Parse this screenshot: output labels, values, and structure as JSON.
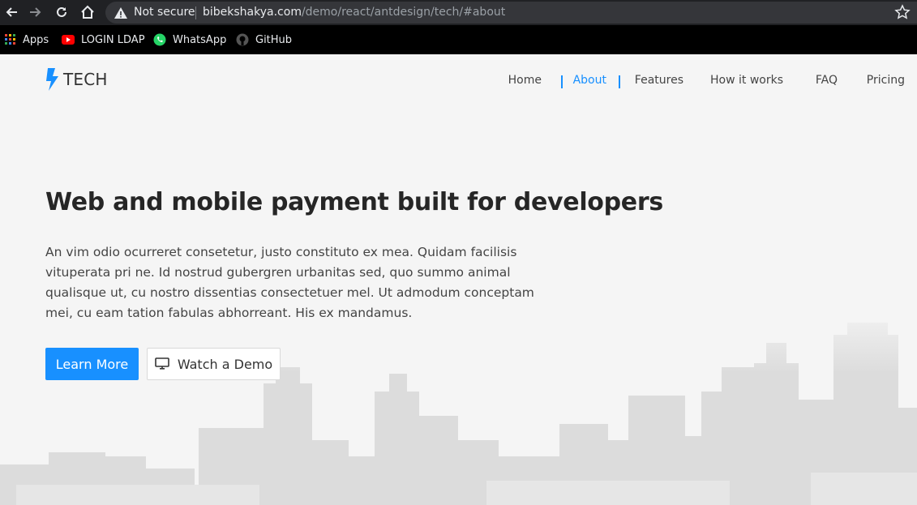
{
  "browser": {
    "security_label": "Not secure",
    "url_host": "bibekshakya.com",
    "url_path": "/demo/react/antdesign/tech/#about",
    "bookmarks": [
      {
        "label": "Apps",
        "icon": "apps-grid-icon"
      },
      {
        "label": "LOGIN LDAP",
        "icon": "youtube-icon"
      },
      {
        "label": "WhatsApp",
        "icon": "whatsapp-icon"
      },
      {
        "label": "GitHub",
        "icon": "github-icon"
      }
    ]
  },
  "header": {
    "logo_text": "TECH",
    "logo_icon": "lightning-bolt-icon",
    "menu": [
      {
        "label": "Home",
        "active": false
      },
      {
        "label": "About",
        "active": true
      },
      {
        "label": "Features",
        "active": false
      },
      {
        "label": "How it works",
        "active": false
      },
      {
        "label": "FAQ",
        "active": false
      },
      {
        "label": "Pricing",
        "active": false
      }
    ]
  },
  "hero": {
    "title": "Web and mobile payment built for developers",
    "description": "An vim odio ocurreret consetetur, justo constituto ex mea. Quidam facilisis vituperata pri ne. Id nostrud gubergren urbanitas sed, quo summo animal qualisque ut, cu nostro dissentias consectetuer mel. Ut admodum conceptam mei, cu eam tation fabulas abhorreant. His ex mandamus.",
    "primary_button": "Learn More",
    "secondary_button": "Watch a Demo",
    "secondary_icon": "desktop-icon"
  },
  "colors": {
    "accent": "#1890ff",
    "chrome_dark": "#202124",
    "page_bg": "#f5f5f5"
  }
}
